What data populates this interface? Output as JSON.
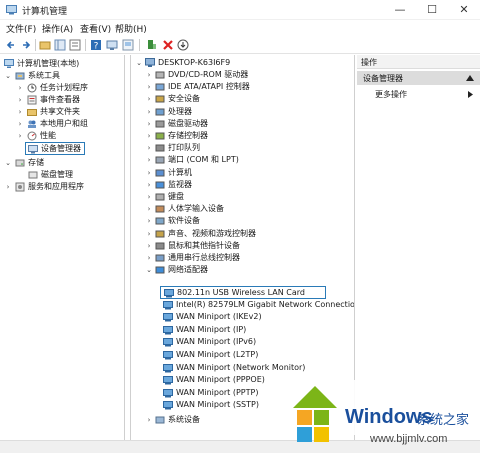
{
  "window": {
    "title": "计算机管理"
  },
  "window_controls": {
    "minimize": "—",
    "maximize": "☐",
    "close": "✕"
  },
  "menu": [
    "文件(F)",
    "操作(A)",
    "查看(V)",
    "帮助(H)"
  ],
  "left_tree": {
    "root": "计算机管理(本地)",
    "system_tools": "系统工具",
    "items": [
      "任务计划程序",
      "事件查看器",
      "共享文件夹",
      "本地用户和组",
      "性能",
      "设备管理器"
    ],
    "storage": "存储",
    "disk_mgmt": "磁盘管理",
    "services": "服务和应用程序"
  },
  "device_tree": {
    "computer": "DESKTOP-K63I6F9",
    "categories": [
      "DVD/CD-ROM 驱动器",
      "IDE ATA/ATAPI 控制器",
      "安全设备",
      "处理器",
      "磁盘驱动器",
      "存储控制器",
      "打印队列",
      "端口 (COM 和 LPT)",
      "计算机",
      "监视器",
      "键盘",
      "人体学输入设备",
      "软件设备",
      "声音、视频和游戏控制器",
      "鼠标和其他指针设备",
      "通用串行总线控制器",
      "网络适配器"
    ],
    "network_adapters": [
      "802.11n USB Wireless LAN Card",
      "Intel(R) 82579LM Gigabit Network Connectio",
      "WAN Miniport (IKEv2)",
      "WAN Miniport (IP)",
      "WAN Miniport (IPv6)",
      "WAN Miniport (L2TP)",
      "WAN Miniport (Network Monitor)",
      "WAN Miniport (PPPOE)",
      "WAN Miniport (PPTP)",
      "WAN Miniport (SSTP)"
    ],
    "last": "系统设备"
  },
  "actions": {
    "header": "操作",
    "selected": "设备管理器",
    "more": "更多操作"
  },
  "watermark": {
    "brand": "Windows",
    "cn": "系统之家",
    "url": "www.bjjmlv.com"
  },
  "colors": {
    "select_border": "#2a7ab7",
    "brand_blue": "#1a4f9c",
    "logo_orange": "#f5a623",
    "logo_green": "#7cb518"
  }
}
